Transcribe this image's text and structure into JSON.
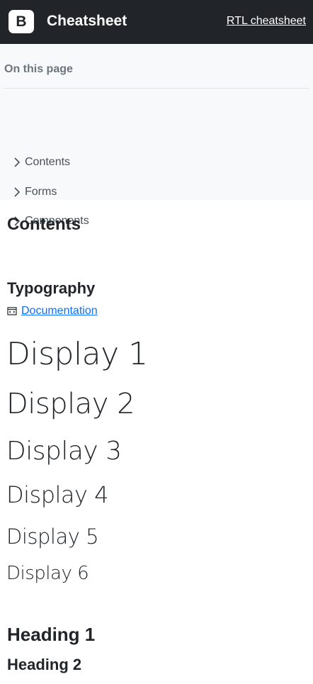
{
  "navbar": {
    "logo_letter": "B",
    "title": "Cheatsheet",
    "rtl_link": "RTL cheatsheet"
  },
  "toc": {
    "title": "On this page",
    "items": [
      {
        "label": "Contents"
      },
      {
        "label": "Forms"
      },
      {
        "label": "Components"
      }
    ]
  },
  "main": {
    "heading": "Contents",
    "section": {
      "title": "Typography",
      "doc_link": "Documentation",
      "displays": [
        "Display 1",
        "Display 2",
        "Display 3",
        "Display 4",
        "Display 5",
        "Display 6"
      ],
      "headings": [
        "Heading 1",
        "Heading 2"
      ]
    }
  },
  "colors": {
    "navbar_bg": "#212529",
    "toc_bg": "#f8f9fa",
    "link": "#0d6efd"
  },
  "icons": {
    "brand": "bootstrap-logo-icon",
    "toc_chevron": "chevron-right-icon",
    "doc": "book-icon"
  }
}
